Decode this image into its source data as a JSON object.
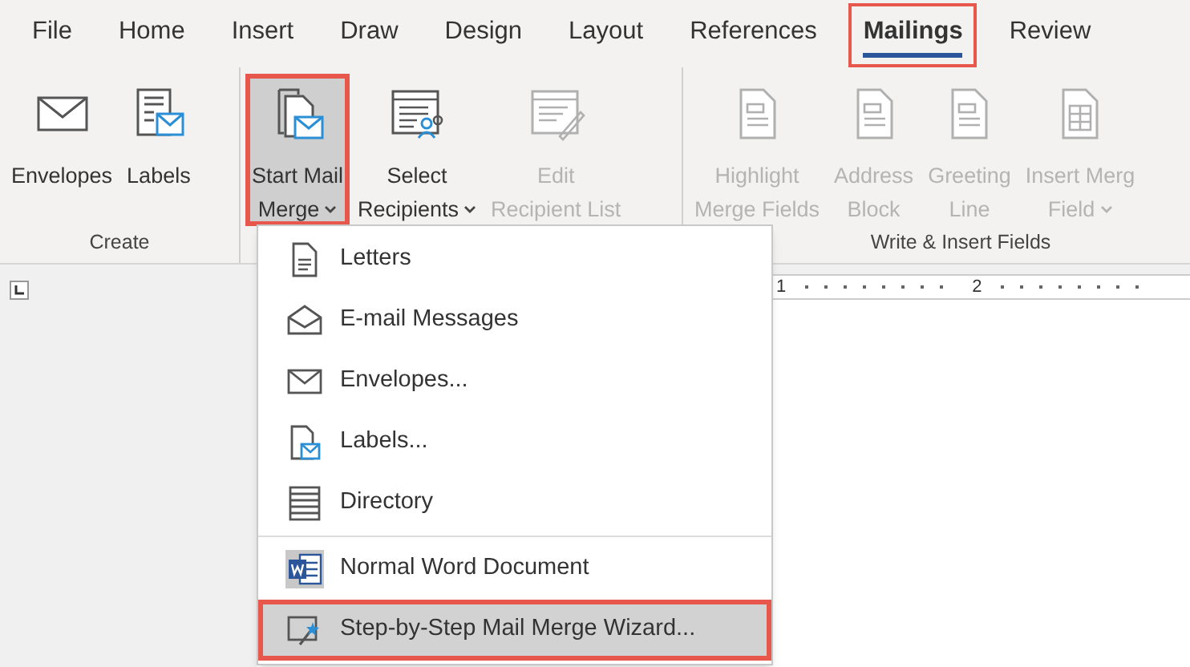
{
  "tabs": [
    {
      "label": "File",
      "selected": false,
      "highlighted": false
    },
    {
      "label": "Home",
      "selected": false,
      "highlighted": false
    },
    {
      "label": "Insert",
      "selected": false,
      "highlighted": false
    },
    {
      "label": "Draw",
      "selected": false,
      "highlighted": false
    },
    {
      "label": "Design",
      "selected": false,
      "highlighted": false
    },
    {
      "label": "Layout",
      "selected": false,
      "highlighted": false
    },
    {
      "label": "References",
      "selected": false,
      "highlighted": false
    },
    {
      "label": "Mailings",
      "selected": true,
      "highlighted": true
    },
    {
      "label": "Review",
      "selected": false,
      "highlighted": false
    }
  ],
  "ribbon_groups": [
    {
      "label": "Create",
      "buttons": [
        {
          "kind": "envelope",
          "lines": [
            "Envelopes"
          ],
          "dropdown": false,
          "disabled": false,
          "highlighted": false
        },
        {
          "kind": "labels",
          "lines": [
            "Labels"
          ],
          "dropdown": false,
          "disabled": false,
          "highlighted": false
        }
      ]
    },
    {
      "buttons": [
        {
          "kind": "startmerge",
          "lines": [
            "Start Mail",
            "Merge"
          ],
          "dropdown": true,
          "disabled": false,
          "highlighted": true
        },
        {
          "kind": "recipients",
          "lines": [
            "Select",
            "Recipients"
          ],
          "dropdown": true,
          "disabled": false,
          "highlighted": false
        },
        {
          "kind": "editlist",
          "lines": [
            "Edit",
            "Recipient List"
          ],
          "dropdown": false,
          "disabled": true,
          "highlighted": false
        }
      ]
    },
    {
      "label": "Write & Insert Fields",
      "buttons": [
        {
          "kind": "doc",
          "lines": [
            "Highlight",
            "Merge Fields"
          ],
          "dropdown": false,
          "disabled": true,
          "highlighted": false
        },
        {
          "kind": "doc",
          "lines": [
            "Address",
            "Block"
          ],
          "dropdown": false,
          "disabled": true,
          "highlighted": false
        },
        {
          "kind": "doc",
          "lines": [
            "Greeting",
            "Line"
          ],
          "dropdown": false,
          "disabled": true,
          "highlighted": false
        },
        {
          "kind": "grid",
          "lines": [
            "Insert Merg",
            "Field"
          ],
          "dropdown": true,
          "disabled": true,
          "highlighted": false
        }
      ]
    }
  ],
  "ruler": {
    "marks": [
      "1",
      "2"
    ]
  },
  "menu": {
    "items": [
      {
        "kind": "letter",
        "label": "Letters",
        "selected": false,
        "highlighted": false
      },
      {
        "kind": "email",
        "label": "E-mail Messages",
        "selected": false,
        "highlighted": false
      },
      {
        "kind": "envelope",
        "label": "Envelopes...",
        "selected": false,
        "highlighted": false
      },
      {
        "kind": "labels",
        "label": "Labels...",
        "selected": false,
        "highlighted": false
      },
      {
        "kind": "directory",
        "label": "Directory",
        "selected": false,
        "highlighted": false
      },
      {
        "kind": "word",
        "label": "Normal Word Document",
        "selected": false,
        "highlighted": false,
        "divider_before": true
      },
      {
        "kind": "wizard",
        "label": "Step-by-Step Mail Merge Wizard...",
        "selected": true,
        "highlighted": true
      }
    ]
  }
}
